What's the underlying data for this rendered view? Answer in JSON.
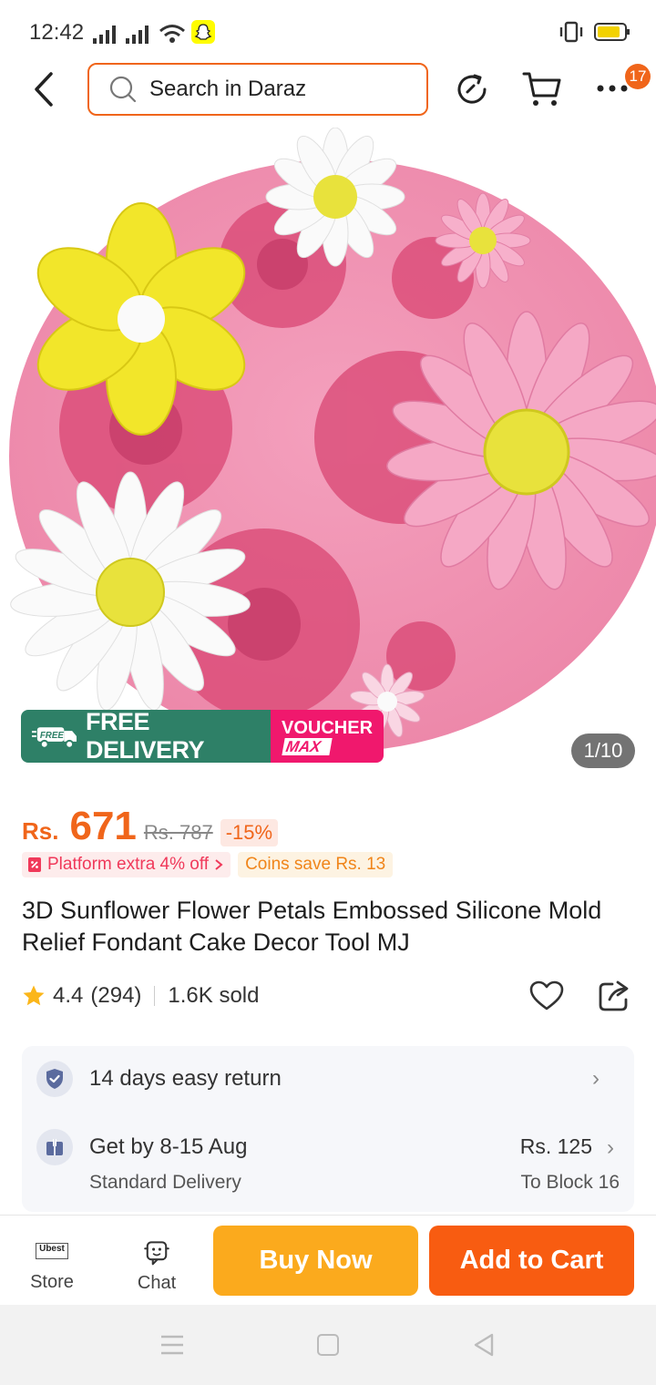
{
  "status_bar": {
    "time": "12:42"
  },
  "topbar": {
    "search_placeholder": "Search in Daraz",
    "more_badge": "17"
  },
  "gallery": {
    "free_label": "FREE",
    "free_delivery": "FREE DELIVERY",
    "voucher_top": "VOUCHER",
    "voucher_bottom": "MAX",
    "page_indicator": "1/10"
  },
  "price": {
    "currency": "Rs.",
    "current": "671",
    "original": "Rs. 787",
    "discount": "-15%"
  },
  "promos": {
    "platform": "Platform extra 4% off",
    "coins": "Coins save Rs. 13"
  },
  "product": {
    "title": "3D Sunflower Flower Petals Embossed Silicone Mold Relief Fondant Cake Decor Tool MJ",
    "rating": "4.4",
    "reviews": "(294)",
    "sold": "1.6K sold"
  },
  "info": {
    "returns": "14 days easy return",
    "delivery": "Get by 8-15 Aug",
    "delivery_type": "Standard Delivery",
    "delivery_price": "Rs. 125",
    "location": "To Block 16"
  },
  "actions": {
    "store_logo": "Ubest",
    "store": "Store",
    "chat": "Chat",
    "buy_now": "Buy Now",
    "add_to_cart": "Add to Cart"
  },
  "colors": {
    "accent": "#f0651a",
    "buy_now": "#fbaa1d",
    "add_to_cart": "#f85c11",
    "free_delivery_bg": "#2e8067",
    "voucher_bg": "#f0186d"
  }
}
